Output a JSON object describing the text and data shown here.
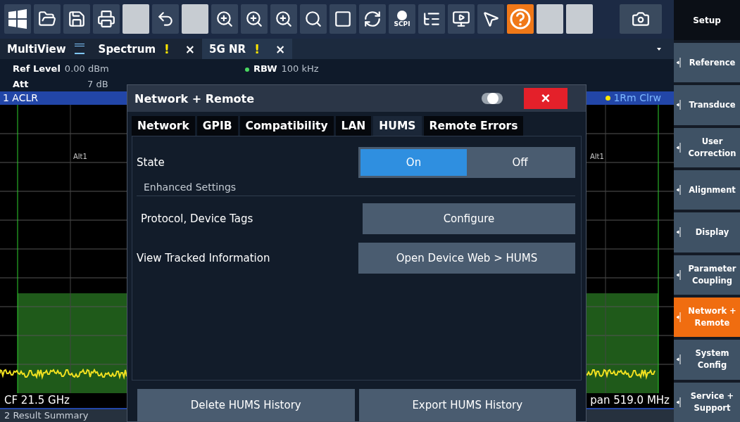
{
  "toolbar": {
    "tools": [
      {
        "kind": "windows"
      },
      {
        "kind": "folder"
      },
      {
        "kind": "save"
      },
      {
        "kind": "print"
      },
      {
        "kind": "blank"
      },
      {
        "kind": "undo"
      },
      {
        "kind": "blank"
      },
      {
        "kind": "zoom"
      },
      {
        "kind": "zoom"
      },
      {
        "kind": "zoom"
      },
      {
        "kind": "search"
      },
      {
        "kind": "frame"
      },
      {
        "kind": "refresh"
      },
      {
        "kind": "scpi",
        "label": "SCPI"
      },
      {
        "kind": "list"
      },
      {
        "kind": "display"
      },
      {
        "kind": "pointer"
      },
      {
        "kind": "help"
      },
      {
        "kind": "blank"
      },
      {
        "kind": "blank"
      },
      {
        "kind": "spacer"
      },
      {
        "kind": "camera"
      }
    ]
  },
  "channel_tabs": [
    {
      "label": "MultiView",
      "kind": "multiview",
      "selected": false
    },
    {
      "label": "Spectrum",
      "kind": "channel",
      "warning": "!",
      "close": "×",
      "selected": false
    },
    {
      "label": "5G NR",
      "kind": "channel",
      "warning": "!",
      "close": "×",
      "selected": true
    }
  ],
  "info": {
    "ref_level_label": "Ref Level",
    "ref_level": "0.00 dBm",
    "att_label": "Att",
    "att": "7 dB",
    "rbw_label": "RBW",
    "rbw": "100 kHz"
  },
  "trace_header": {
    "title": "1 ACLR",
    "trace": "1Rm Clrw"
  },
  "plot": {
    "marker_labels": [
      "Alt1",
      "Alt1"
    ]
  },
  "footer": {
    "left": "CF 21.5 GHz",
    "right": "pan 519.0 MHz",
    "next_window": "2 Result Summary"
  },
  "sidebar": {
    "title": "Setup",
    "items": [
      {
        "label": "Reference",
        "selected": false
      },
      {
        "label": "Transduce",
        "selected": false
      },
      {
        "label": "User Correction",
        "selected": false
      },
      {
        "label": "Alignment",
        "selected": false
      },
      {
        "label": "Display",
        "selected": false
      },
      {
        "label": "Parameter Coupling",
        "selected": false
      },
      {
        "label": "Network + Remote",
        "selected": true
      },
      {
        "label": "System Config",
        "selected": false
      },
      {
        "label": "Service + Support",
        "selected": false
      }
    ]
  },
  "dialog": {
    "title": "Network + Remote",
    "toggle_on": false,
    "close": "×",
    "tabs": [
      {
        "label": "Network",
        "selected": false
      },
      {
        "label": "GPIB",
        "selected": false
      },
      {
        "label": "Compatibility",
        "selected": false
      },
      {
        "label": "LAN",
        "selected": false
      },
      {
        "label": "HUMS",
        "selected": true
      },
      {
        "label": "Remote Errors",
        "selected": false
      }
    ],
    "state": {
      "label": "State",
      "options": [
        {
          "label": "On",
          "selected": true
        },
        {
          "label": "Off",
          "selected": false
        }
      ]
    },
    "section": "Enhanced Settings",
    "rows": [
      {
        "label": "Protocol, Device Tags",
        "button": "Configure"
      },
      {
        "label": "View Tracked Information",
        "button": "Open Device Web > HUMS"
      }
    ],
    "bottom_buttons": [
      "Delete HUMS History",
      "Export HUMS History"
    ]
  }
}
